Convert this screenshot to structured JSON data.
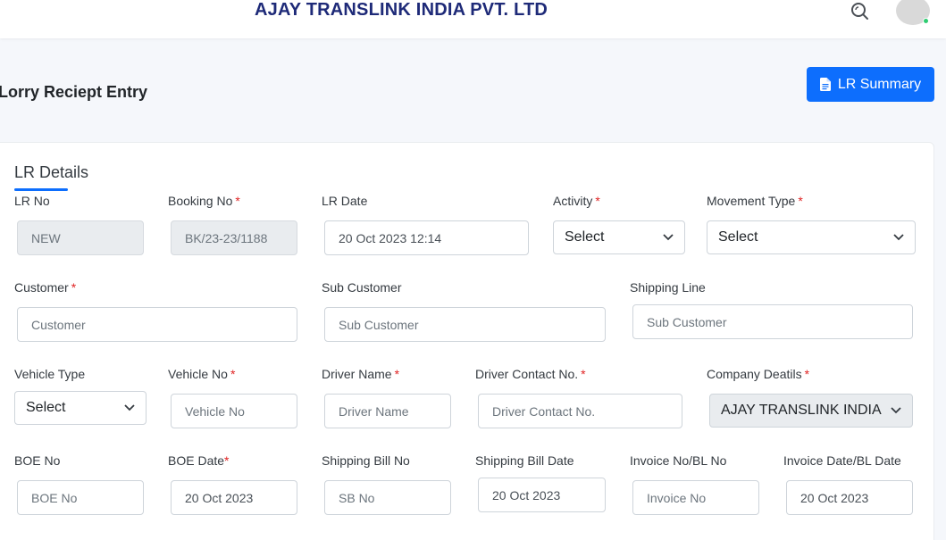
{
  "header": {
    "brand": "AJAY TRANSLINK INDIA PVT. LTD"
  },
  "page": {
    "title": "Lorry Reciept Entry",
    "summary_button": "LR Summary"
  },
  "section": {
    "title": "LR Details"
  },
  "fields": {
    "lr_no": {
      "label": "LR No",
      "value": "NEW"
    },
    "booking_no": {
      "label": "Booking No",
      "value": "BK/23-23/1188"
    },
    "lr_date": {
      "label": "LR Date",
      "value": "20 Oct 2023 12:14"
    },
    "activity": {
      "label": "Activity",
      "value": "Select"
    },
    "movement_type": {
      "label": "Movement Type",
      "value": "Select"
    },
    "customer": {
      "label": "Customer",
      "placeholder": "Customer"
    },
    "sub_customer": {
      "label": "Sub Customer",
      "placeholder": "Sub Customer"
    },
    "shipping_line": {
      "label": "Shipping Line",
      "placeholder": "Sub Customer"
    },
    "vehicle_type": {
      "label": "Vehicle Type",
      "value": "Select"
    },
    "vehicle_no": {
      "label": "Vehicle No",
      "placeholder": "Vehicle No"
    },
    "driver_name": {
      "label": "Driver Name",
      "placeholder": "Driver Name"
    },
    "driver_contact": {
      "label": "Driver Contact No.",
      "placeholder": "Driver Contact No."
    },
    "company_details": {
      "label": "Company Deatils",
      "value": "AJAY TRANSLINK INDIA"
    },
    "boe_no": {
      "label": "BOE No",
      "placeholder": "BOE No"
    },
    "boe_date": {
      "label": "BOE Date",
      "value": "20 Oct 2023"
    },
    "shipping_bill_no": {
      "label": "Shipping Bill No",
      "placeholder": "SB No"
    },
    "shipping_bill_date": {
      "label": "Shipping Bill Date",
      "value": "20 Oct 2023"
    },
    "invoice_no": {
      "label": "Invoice No/BL No",
      "placeholder": "Invoice No"
    },
    "invoice_date": {
      "label": "Invoice Date/BL Date",
      "value": "20 Oct 2023"
    }
  },
  "required_marker": "*",
  "colors": {
    "primary": "#0d6efd",
    "brand": "#1e2a78",
    "required": "#e02424",
    "online": "#2ecc71"
  }
}
